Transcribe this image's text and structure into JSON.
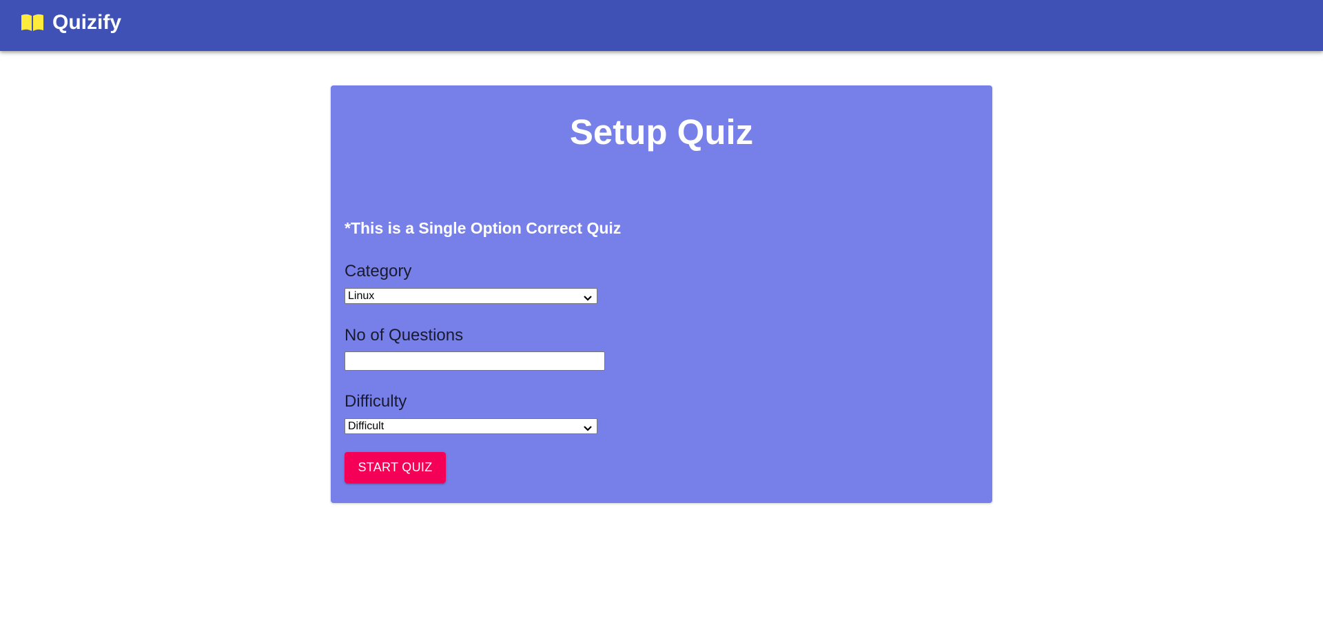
{
  "header": {
    "title": "Quizify",
    "icon": "book-icon",
    "icon_color": "#ffeb3b",
    "background": "#3f51b5"
  },
  "setup": {
    "title": "Setup Quiz",
    "note": "*This is a Single Option Correct Quiz",
    "category": {
      "label": "Category",
      "selected": "Linux"
    },
    "questions": {
      "label": "No of Questions",
      "value": ""
    },
    "difficulty": {
      "label": "Difficulty",
      "selected": "Difficult"
    },
    "start_label": "START QUIZ",
    "card_color": "#7780e8",
    "button_color": "#f50057"
  }
}
